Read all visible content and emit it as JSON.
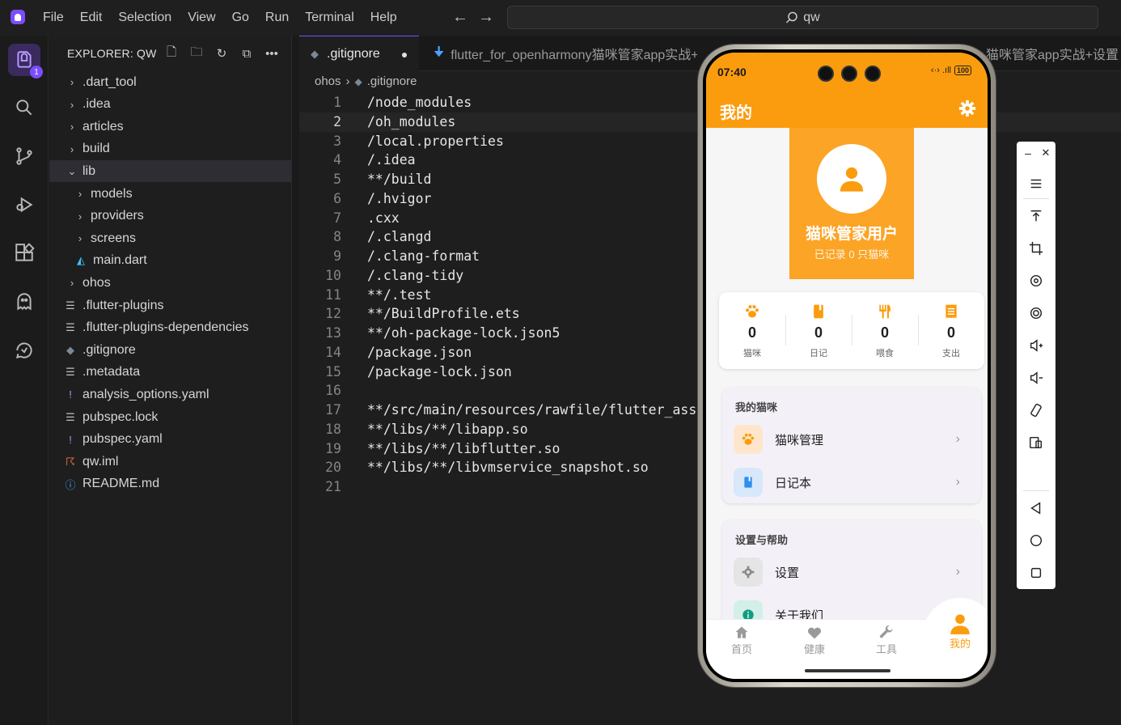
{
  "menu": [
    "File",
    "Edit",
    "Selection",
    "View",
    "Go",
    "Run",
    "Terminal",
    "Help"
  ],
  "search": {
    "text": "qw"
  },
  "activity": {
    "badge": "1"
  },
  "explorer": {
    "title": "EXPLORER: QW",
    "items": [
      {
        "label": ".dart_tool",
        "kind": "folder",
        "open": false,
        "depth": 0
      },
      {
        "label": ".idea",
        "kind": "folder",
        "open": false,
        "depth": 0
      },
      {
        "label": "articles",
        "kind": "folder",
        "open": false,
        "depth": 0
      },
      {
        "label": "build",
        "kind": "folder",
        "open": false,
        "depth": 0
      },
      {
        "label": "lib",
        "kind": "folder",
        "open": true,
        "depth": 0
      },
      {
        "label": "models",
        "kind": "folder",
        "open": false,
        "depth": 1
      },
      {
        "label": "providers",
        "kind": "folder",
        "open": false,
        "depth": 1
      },
      {
        "label": "screens",
        "kind": "folder",
        "open": false,
        "depth": 1
      },
      {
        "label": "main.dart",
        "kind": "dart",
        "depth": 1
      },
      {
        "label": "ohos",
        "kind": "folder",
        "open": false,
        "depth": 0
      },
      {
        "label": ".flutter-plugins",
        "kind": "lines",
        "depth": 0
      },
      {
        "label": ".flutter-plugins-dependencies",
        "kind": "lines",
        "depth": 0
      },
      {
        "label": ".gitignore",
        "kind": "git",
        "depth": 0
      },
      {
        "label": ".metadata",
        "kind": "lines",
        "depth": 0
      },
      {
        "label": "analysis_options.yaml",
        "kind": "yaml",
        "depth": 0
      },
      {
        "label": "pubspec.lock",
        "kind": "lines",
        "depth": 0
      },
      {
        "label": "pubspec.yaml",
        "kind": "yaml",
        "depth": 0
      },
      {
        "label": "qw.iml",
        "kind": "rss",
        "depth": 0
      },
      {
        "label": "README.md",
        "kind": "info",
        "depth": 0
      }
    ]
  },
  "tabs": {
    "active": ".gitignore",
    "second": "flutter_for_openharmony猫咪管家app实战+设",
    "third": "猫咪管家app实战+设置"
  },
  "breadcrumb": {
    "folder": "ohos",
    "file": ".gitignore"
  },
  "code": {
    "lines": [
      "/node_modules",
      "/oh_modules",
      "/local.properties",
      "/.idea",
      "**/build",
      "/.hvigor",
      ".cxx",
      "/.clangd",
      "/.clang-format",
      "/.clang-tidy",
      "**/.test",
      "**/BuildProfile.ets",
      "**/oh-package-lock.json5",
      "/package.json",
      "/package-lock.json",
      "",
      "**/src/main/resources/rawfile/flutter_asset",
      "**/libs/**/libapp.so",
      "**/libs/**/libflutter.so",
      "**/libs/**/libvmservice_snapshot.so",
      ""
    ],
    "current_line": 2
  },
  "phone": {
    "time": "07:40",
    "battery": "100",
    "title": "我的",
    "user_name": "猫咪管家用户",
    "user_sub": "已记录 0 只猫咪",
    "stats": [
      {
        "value": "0",
        "label": "猫咪",
        "icon": "paw-icon"
      },
      {
        "value": "0",
        "label": "日记",
        "icon": "book-icon"
      },
      {
        "value": "0",
        "label": "喂食",
        "icon": "utensils-icon"
      },
      {
        "value": "0",
        "label": "支出",
        "icon": "receipt-icon"
      }
    ],
    "section1": {
      "title": "我的猫咪",
      "items": [
        "猫咪管理",
        "日记本"
      ]
    },
    "section2": {
      "title": "设置与帮助",
      "items": [
        "设置",
        "关于我们"
      ]
    },
    "nav": [
      "首页",
      "健康",
      "工具",
      "我的"
    ],
    "accent": "#fb9c0e"
  }
}
